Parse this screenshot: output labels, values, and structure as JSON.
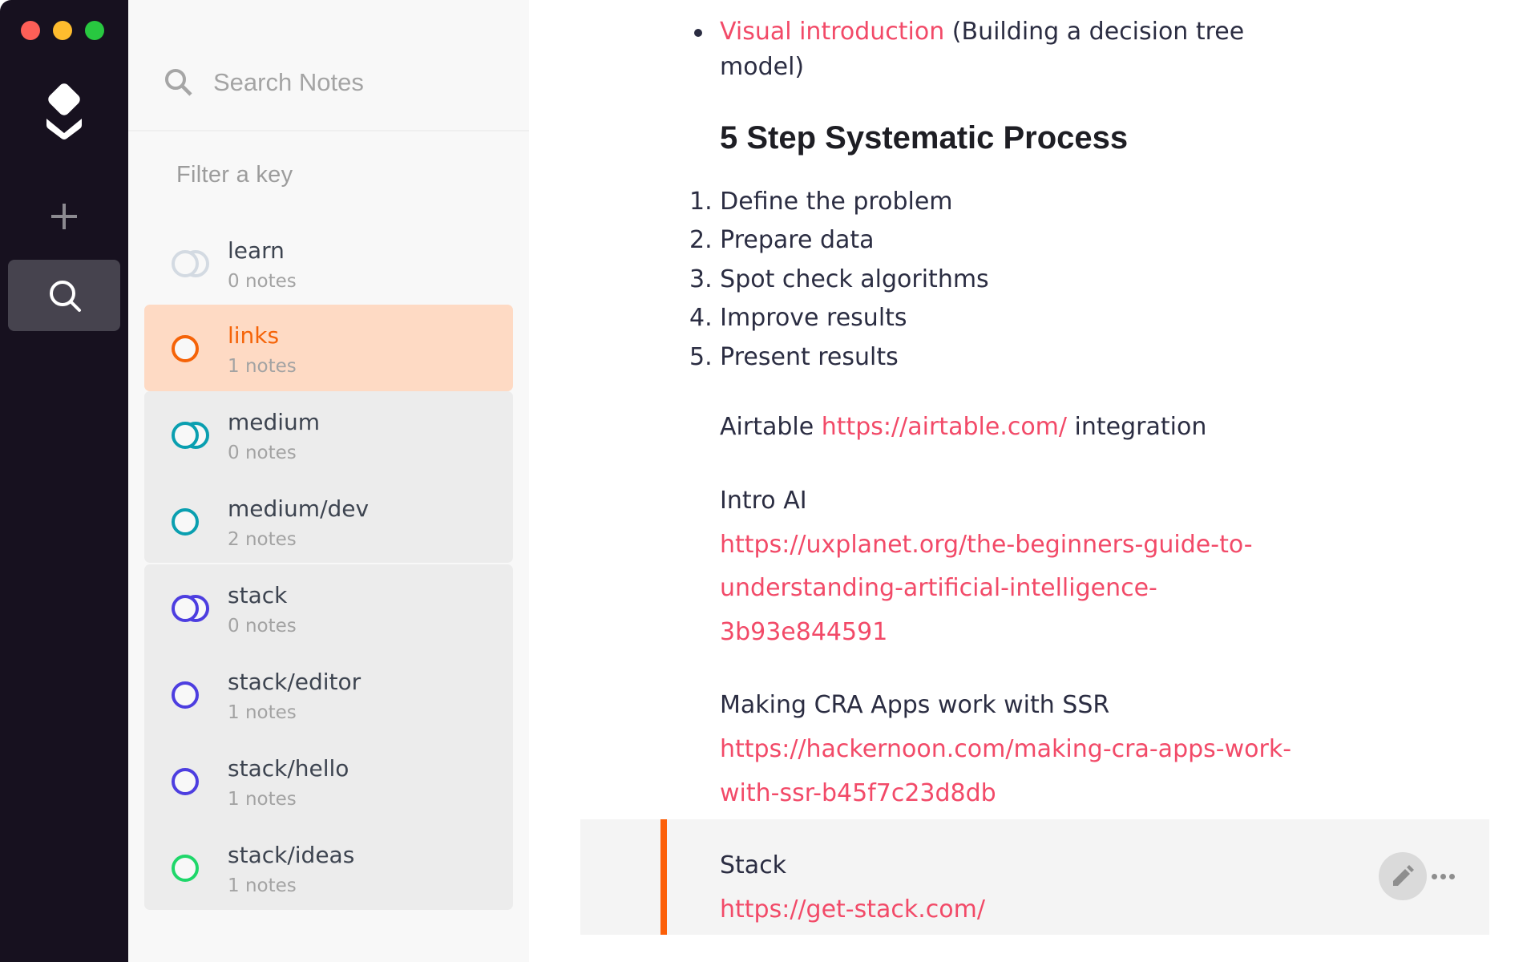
{
  "window": {
    "traffic_lights": [
      {
        "name": "close",
        "color": "#fe5f57"
      },
      {
        "name": "minimize",
        "color": "#febc2e"
      },
      {
        "name": "maximize",
        "color": "#28c840"
      }
    ]
  },
  "rail": {
    "logo_icon": "stack-layers-logo-icon",
    "add_icon": "plus-icon",
    "search_icon": "search-icon"
  },
  "panel": {
    "search": {
      "placeholder": "Search Notes",
      "value": ""
    },
    "filter_label": "Filter a key",
    "keys": [
      {
        "name": "learn",
        "count": "0 notes",
        "icon": "double-ring-icon",
        "color": "#d3dae2",
        "selected": false
      },
      {
        "name": "links",
        "count": "1 notes",
        "icon": "ring-icon",
        "color": "#f56308",
        "selected": true
      },
      {
        "name": "medium",
        "count": "0 notes",
        "icon": "double-ring-icon",
        "color": "#0a9fb0",
        "selected": false
      },
      {
        "name": "medium/dev",
        "count": "2 notes",
        "icon": "ring-icon",
        "color": "#0a9fb0",
        "selected": false
      },
      {
        "name": "stack",
        "count": "0 notes",
        "icon": "double-ring-icon",
        "color": "#4d3ee0",
        "selected": false
      },
      {
        "name": "stack/editor",
        "count": "1 notes",
        "icon": "ring-icon",
        "color": "#4d3ee0",
        "selected": false
      },
      {
        "name": "stack/hello",
        "count": "1 notes",
        "icon": "ring-icon",
        "color": "#4d3ee0",
        "selected": false
      },
      {
        "name": "stack/ideas",
        "count": "1 notes",
        "icon": "ring-icon",
        "color": "#1fd76a",
        "selected": false
      }
    ]
  },
  "content": {
    "bullet": {
      "link_text": "Visual introduction",
      "text_line1": " (Building a decision tree",
      "text_line2": "model)"
    },
    "heading": "5 Step Systematic Process",
    "steps": [
      "1. Define the problem",
      "2. Prepare data",
      "3. Spot check algorithms",
      "4. Improve results",
      "5. Present results"
    ],
    "airtable": {
      "prefix": "Airtable ",
      "link": "https://airtable.com/",
      "suffix": " integration"
    },
    "intro_ai": {
      "title": "Intro AI",
      "link_lines": [
        "https://uxplanet.org/the-beginners-guide-to-",
        "understanding-artificial-intelligence-",
        "3b93e844591"
      ]
    },
    "cra": {
      "title": "Making CRA Apps work with SSR",
      "link_lines": [
        "https://hackernoon.com/making-cra-apps-work-",
        "with-ssr-b45f7c23d8db"
      ]
    },
    "active_note": {
      "title": "Stack",
      "link": "https://get-stack.com/",
      "accent_color": "#fc5f08",
      "edit_icon": "pencil-icon",
      "more_icon": "more-horizontal-icon"
    }
  },
  "colors": {
    "link": "#f24a68",
    "accent": "#f56308"
  }
}
